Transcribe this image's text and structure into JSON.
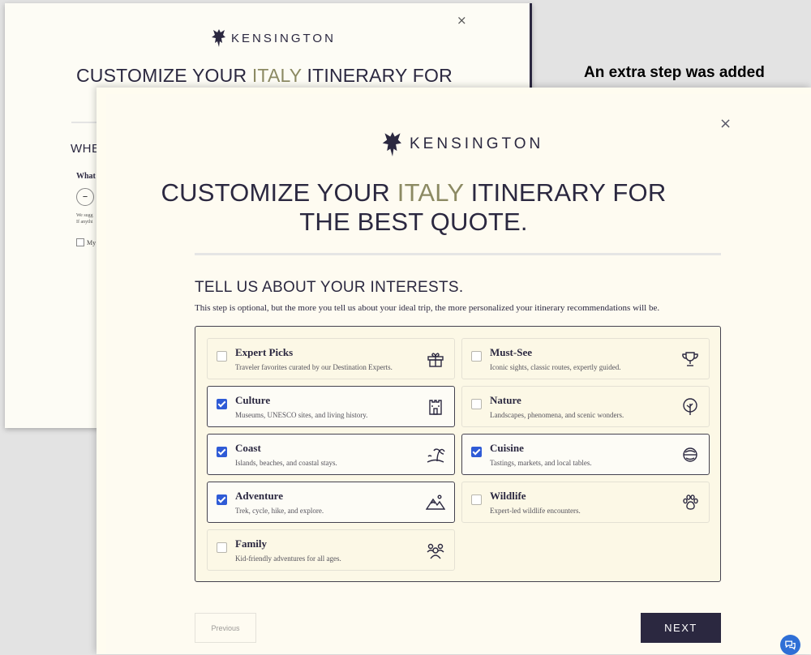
{
  "back_modal": {
    "close_symbol": "×",
    "brand": "KENSINGTON",
    "headline_pre": "CUSTOMIZE YOUR ",
    "headline_accent": "ITALY",
    "headline_post": " ITINERARY FOR",
    "section_title_partial": "WHE",
    "question_partial": "What",
    "stepper_minus": "–",
    "note_line1": "We sugg",
    "note_line2": "If anythi",
    "checkbox_partial": "My"
  },
  "annotation": "An extra step was added",
  "modal": {
    "close_symbol": "×",
    "brand": "KENSINGTON",
    "headline_pre": "CUSTOMIZE YOUR ",
    "headline_accent": "ITALY",
    "headline_post": " ITINERARY FOR",
    "headline_line2": "THE BEST QUOTE.",
    "section_title": "TELL US ABOUT YOUR INTERESTS.",
    "section_desc": "This step is optional, but the more you tell us about your ideal trip, the more personalized your itinerary recommendations will be.",
    "options": [
      {
        "title": "Expert Picks",
        "desc": "Traveler favorites curated by our Destination Experts.",
        "checked": false,
        "icon": "gift-icon"
      },
      {
        "title": "Must-See",
        "desc": "Iconic sights, classic routes, expertly guided.",
        "checked": false,
        "icon": "trophy-icon"
      },
      {
        "title": "Culture",
        "desc": "Museums, UNESCO sites, and living history.",
        "checked": true,
        "icon": "castle-icon"
      },
      {
        "title": "Nature",
        "desc": "Landscapes, phenomena, and scenic wonders.",
        "checked": false,
        "icon": "tree-icon"
      },
      {
        "title": "Coast",
        "desc": "Islands, beaches, and coastal stays.",
        "checked": true,
        "icon": "palm-island-icon"
      },
      {
        "title": "Cuisine",
        "desc": "Tastings, markets, and local tables.",
        "checked": true,
        "icon": "food-bowl-icon"
      },
      {
        "title": "Adventure",
        "desc": "Trek, cycle, hike, and explore.",
        "checked": true,
        "icon": "mountain-icon"
      },
      {
        "title": "Wildlife",
        "desc": "Expert-led wildlife encounters.",
        "checked": false,
        "icon": "paw-icon"
      },
      {
        "title": "Family",
        "desc": "Kid-friendly adventures for all ages.",
        "checked": false,
        "icon": "family-icon"
      }
    ],
    "prev_label": "Previous",
    "next_label": "NEXT"
  },
  "colors": {
    "navy": "#2b2840",
    "accent_olive": "#8c8a63",
    "checkbox_blue": "#2f5bd6",
    "chat_blue": "#2f6fd6"
  }
}
